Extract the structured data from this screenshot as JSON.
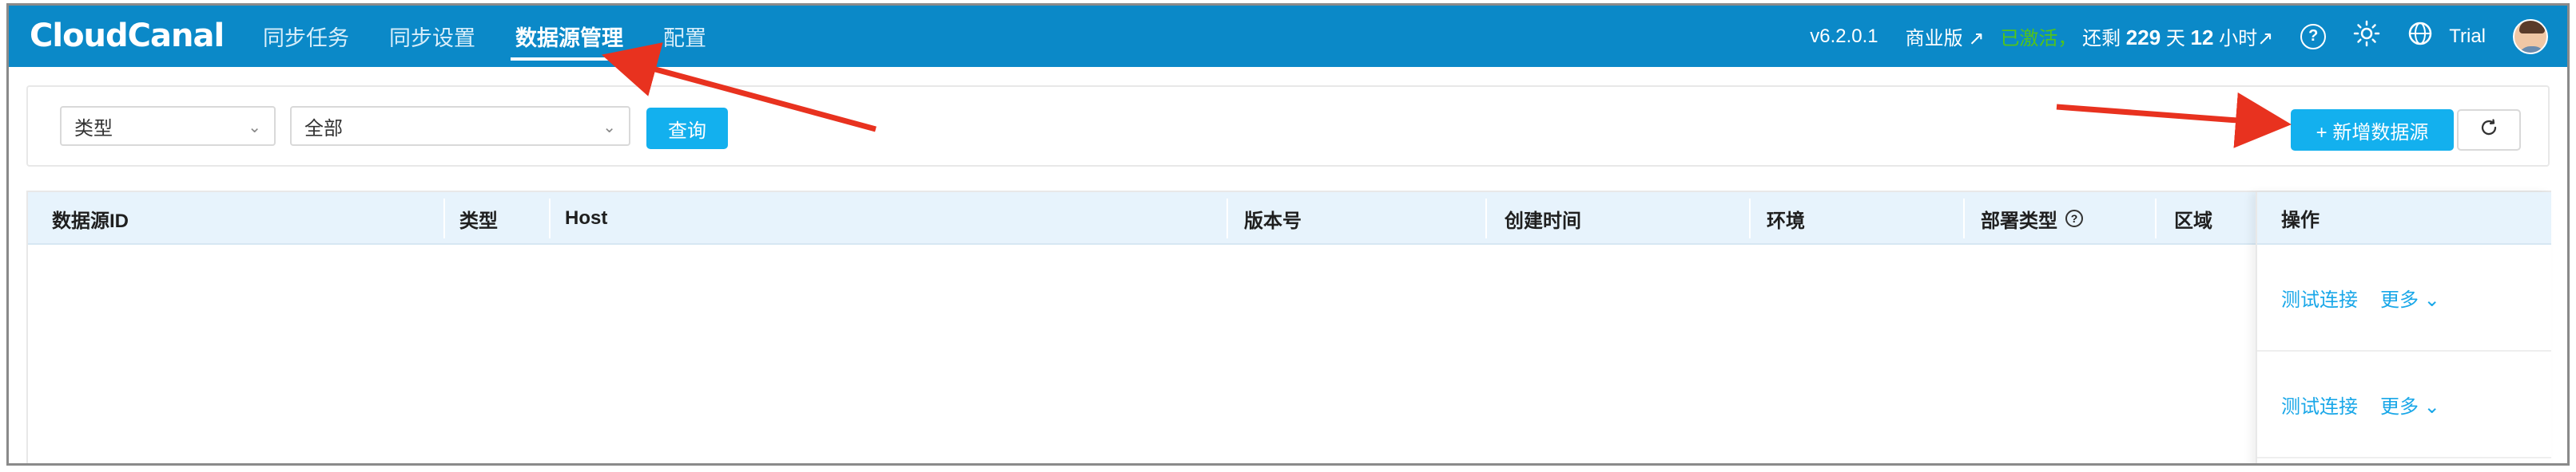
{
  "app": {
    "logo": "CloudCanal"
  },
  "nav": {
    "items": [
      {
        "label": "同步任务",
        "active": false
      },
      {
        "label": "同步设置",
        "active": false
      },
      {
        "label": "数据源管理",
        "active": true
      },
      {
        "label": "配置",
        "active": false
      }
    ]
  },
  "header": {
    "version": "v6.2.0.1",
    "edition": "商业版 ↗",
    "activated": "已激活，",
    "remain_prefix": "还剩",
    "days": "229",
    "days_unit": "天",
    "hours": "12",
    "hours_unit": "小时↗",
    "trial": "Trial"
  },
  "filters": {
    "type_select": "类型",
    "all_select": "全部",
    "query_button": "查询",
    "add_button": "+ 新增数据源"
  },
  "table": {
    "columns": [
      "数据源ID",
      "类型",
      "Host",
      "版本号",
      "创建时间",
      "环境",
      "部署类型",
      "区域"
    ],
    "ops_header": "操作",
    "rows": [
      {
        "test": "测试连接",
        "more": "更多 ⌄"
      },
      {
        "test": "测试连接",
        "more": "更多 ⌄"
      }
    ]
  },
  "colors": {
    "topbar": "#0b89c8",
    "primary": "#13b0ee",
    "arrow": "#e8321f",
    "activated": "#52c41a"
  }
}
